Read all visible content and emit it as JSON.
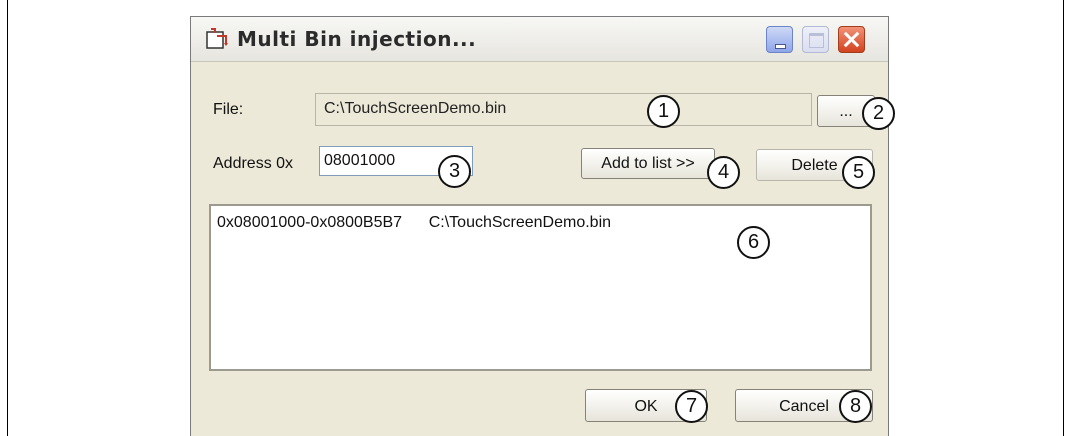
{
  "window": {
    "title": "Multi Bin injection..."
  },
  "form": {
    "file_label": "File:",
    "file_value": "C:\\TouchScreenDemo.bin",
    "browse_label": "...",
    "address_label": "Address 0x",
    "address_value": "08001000",
    "add_label": "Add to list >>",
    "delete_label": "Delete"
  },
  "list": {
    "items": [
      {
        "range": "0x08001000-0x0800B5B7",
        "path": "C:\\TouchScreenDemo.bin"
      }
    ]
  },
  "footer": {
    "ok_label": "OK",
    "cancel_label": "Cancel"
  },
  "callouts": [
    "1",
    "2",
    "3",
    "4",
    "5",
    "6",
    "7",
    "8"
  ],
  "icons": {
    "app": "app-icon",
    "minimize": "minimize-icon",
    "maximize": "maximize-icon",
    "close": "close-icon"
  },
  "colors": {
    "dialog_bg": "#ece9d8",
    "close_button": "#d2431f",
    "minimize_button": "#8ea6ea"
  }
}
